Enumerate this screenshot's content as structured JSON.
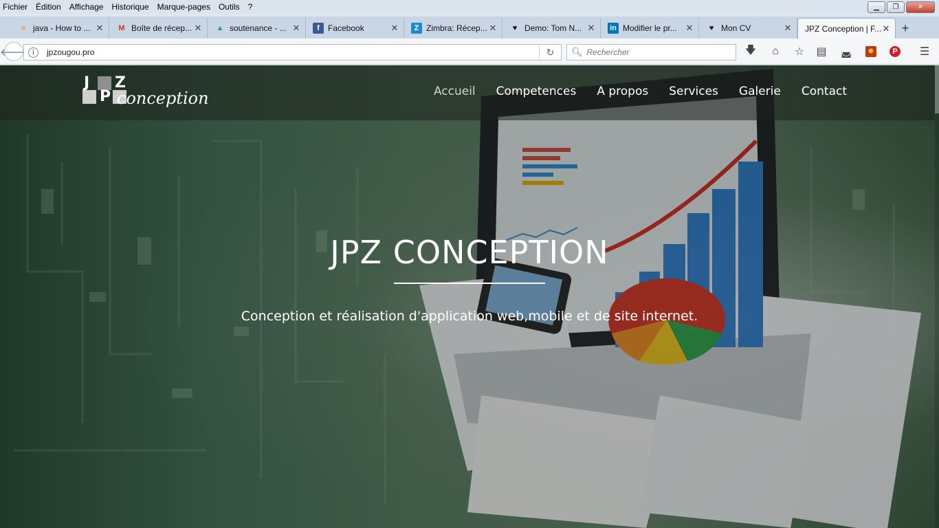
{
  "menubar": {
    "items": [
      "Fichier",
      "Édition",
      "Affichage",
      "Historique",
      "Marque-pages",
      "Outils",
      "?"
    ]
  },
  "tabs": [
    {
      "title": "java - How to ...",
      "icon": "stackoverflow-icon",
      "icon_color": "#f48024"
    },
    {
      "title": "Boîte de récep...",
      "icon": "gmail-icon",
      "icon_color": "#d93025"
    },
    {
      "title": "soutenance - ...",
      "icon": "drive-icon",
      "icon_color": "#1fa463"
    },
    {
      "title": "Facebook",
      "icon": "facebook-icon",
      "icon_color": "#3b5998"
    },
    {
      "title": "Zimbra: Récep...",
      "icon": "zimbra-icon",
      "icon_color": "#1f8acb"
    },
    {
      "title": "Demo: Tom N...",
      "icon": "heart-icon",
      "icon_color": "#111111"
    },
    {
      "title": "Modifier le pr...",
      "icon": "linkedin-icon",
      "icon_color": "#0077b5"
    },
    {
      "title": "Mon CV",
      "icon": "heart-icon",
      "icon_color": "#111111"
    },
    {
      "title": "JPZ Conception | F...",
      "icon": "",
      "icon_color": "",
      "active": true
    }
  ],
  "navbar": {
    "url": "jpzougou.pro",
    "search_placeholder": "Rechercher"
  },
  "site": {
    "logo": {
      "l1": "J",
      "l2": "Z",
      "l3": "P",
      "script": "conception"
    },
    "nav": [
      "Accueil",
      "Competences",
      "A propos",
      "Services",
      "Galerie",
      "Contact"
    ],
    "hero_title": "JPZ CONCEPTION",
    "hero_subtitle": "Conception et réalisation d'application web,mobile et de site internet."
  },
  "colors": {
    "accent_nav_current": "#cfd6cf",
    "hero_bg": "#47715a"
  }
}
